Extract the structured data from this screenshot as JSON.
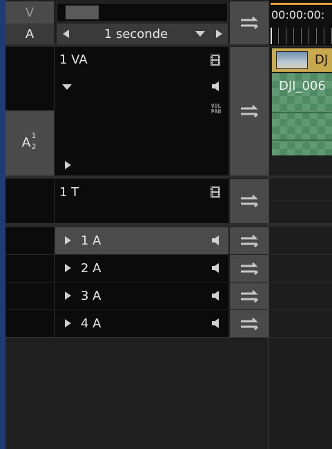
{
  "header": {
    "v_label": "V",
    "a_label": "A",
    "scale_value": "1 seconde"
  },
  "tracks": {
    "video_audio": {
      "name": "1 VA",
      "ab_label": "A",
      "ab_sup": "1",
      "ab_sub": "2",
      "vol_top": "VOL",
      "vol_bottom": "PAN"
    },
    "title": {
      "name": "1 T"
    },
    "audio": [
      {
        "name": "1 A"
      },
      {
        "name": "2 A"
      },
      {
        "name": "3 A"
      },
      {
        "name": "4 A"
      }
    ]
  },
  "timeline": {
    "timecode": "00:00:00:",
    "clip_video_label": "DJ",
    "clip_audio_label": "DJI_006"
  },
  "icons": [
    "swap-icon",
    "film-icon",
    "speaker-icon",
    "triangle-right-icon",
    "triangle-left-icon",
    "triangle-down-icon"
  ]
}
